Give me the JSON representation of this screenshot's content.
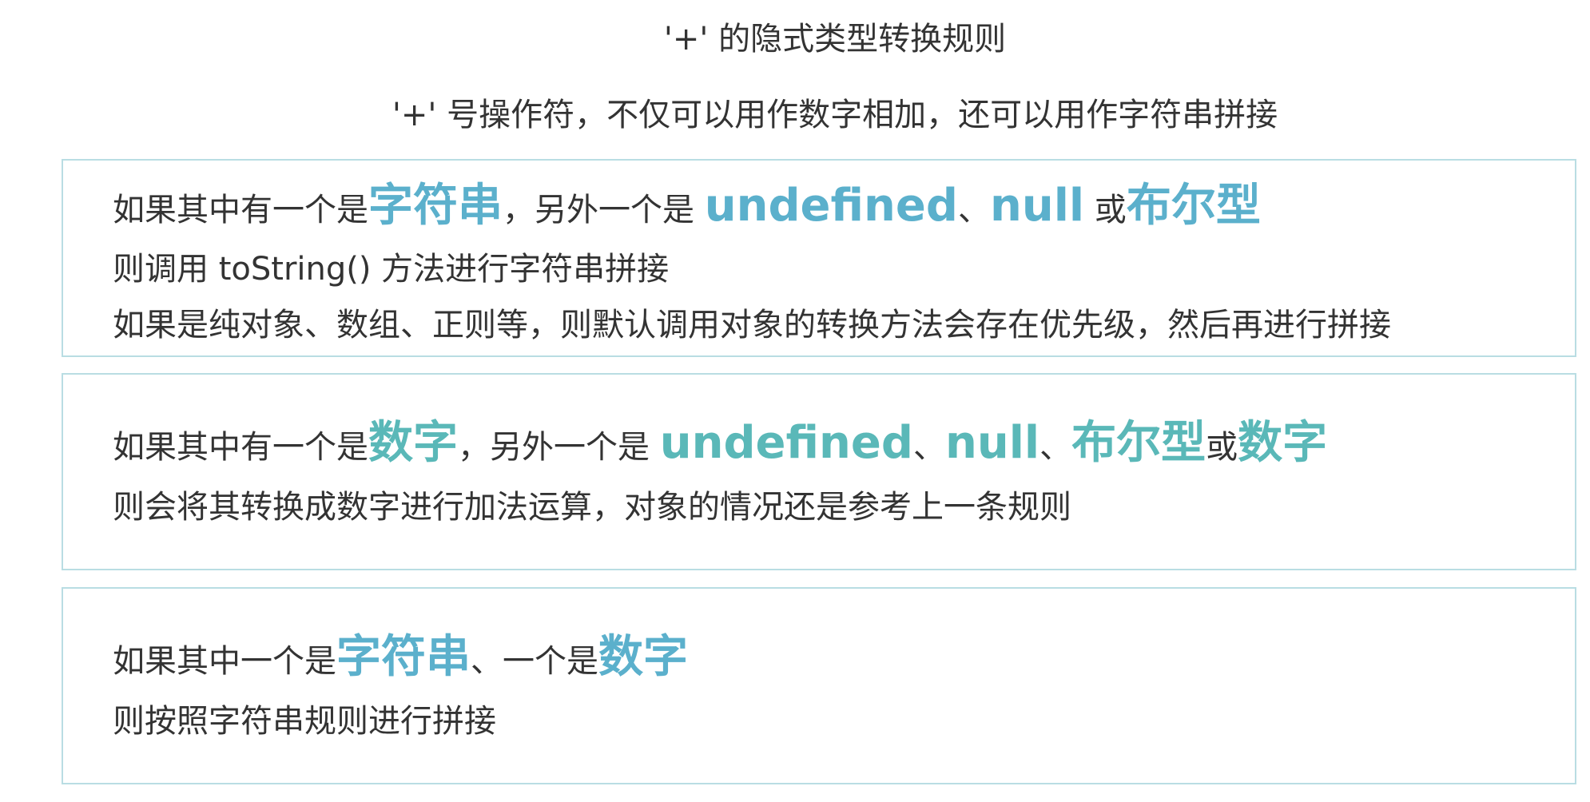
{
  "title": "'+' 的隐式类型转换规则",
  "subtitle": "'+' 号操作符，不仅可以用作数字相加，还可以用作字符串拼接",
  "rules": [
    {
      "line1": {
        "t1": "如果其中有一个是",
        "h1": "字符串",
        "t2": "，另外一个是 ",
        "h2": "undefined",
        "t3": "、",
        "h3": "null",
        "t4": " 或",
        "h4": "布尔型"
      },
      "line2": "则调用 toString() 方法进行字符串拼接",
      "line3": "如果是纯对象、数组、正则等，则默认调用对象的转换方法会存在优先级，然后再进行拼接"
    },
    {
      "line1": {
        "t1": "如果其中有一个是",
        "h1": "数字",
        "t2": "，另外一个是 ",
        "h2": "undefined",
        "t3": "、",
        "h3": "null",
        "t4": "、",
        "h4": "布尔型",
        "t5": "或",
        "h5": "数字"
      },
      "line2": "则会将其转换成数字进行加法运算，对象的情况还是参考上一条规则"
    },
    {
      "line1": {
        "t1": "如果其中一个是",
        "h1": "字符串",
        "t2": "、一个是",
        "h2": "数字"
      },
      "line2": "则按照字符串规则进行拼接"
    }
  ],
  "colors": {
    "highlight_blue": "#5bb0cc",
    "highlight_teal": "#5ab8b8",
    "box_border": "#b9dde3",
    "text": "#333333"
  }
}
